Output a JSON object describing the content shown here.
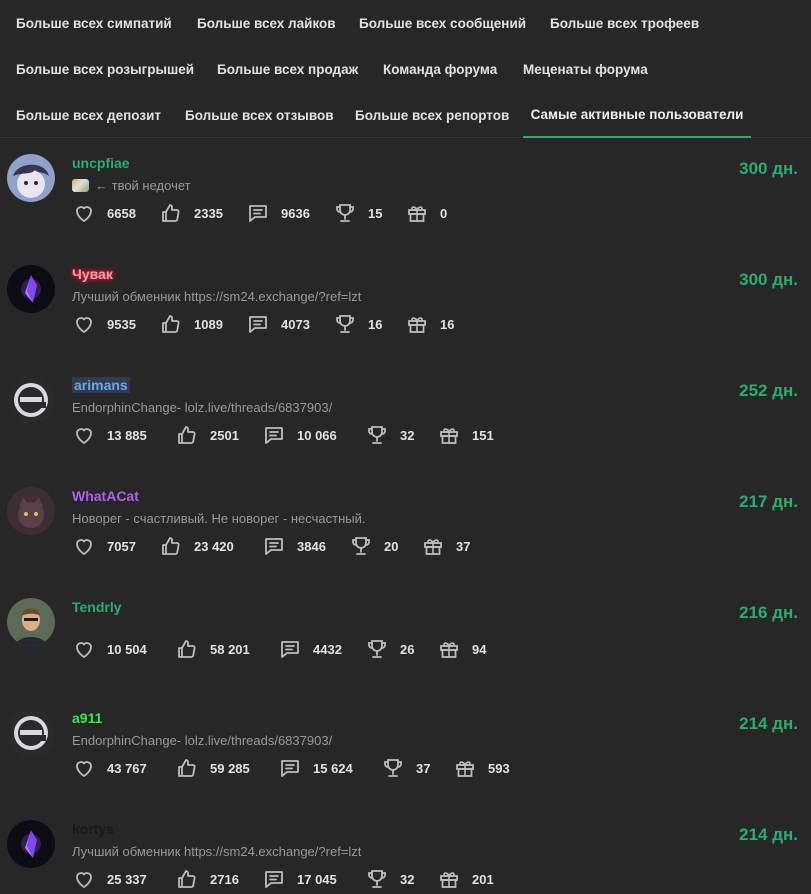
{
  "tabs": {
    "row1": [
      "Больше всех симпатий",
      "Больше всех лайков",
      "Больше всех сообщений",
      "Больше всех трофеев"
    ],
    "row2": [
      "Больше всех розыгрышей",
      "Больше всех продаж",
      "Команда форума",
      "Меценаты форума"
    ],
    "row3": [
      "Больше всех депозит",
      "Больше всех отзывов",
      "Больше всех репортов",
      "Самые активные пользователи"
    ],
    "active": "Самые активные пользователи"
  },
  "colors": {
    "accent": "#2bad72",
    "background": "#272727"
  },
  "users": [
    {
      "name": "uncpfiae",
      "name_color": "#2bad72",
      "name_style": "plain",
      "status": "← твой недочет",
      "status_has_emoji": true,
      "days": "300 дн.",
      "avatar": "anime-avatar",
      "stats": {
        "sympathies": "6658",
        "likes": "2335",
        "messages": "9636",
        "trophies": "15",
        "giveaways": "0"
      }
    },
    {
      "name": "Чувак",
      "name_color": "#ff5a6e",
      "name_style": "glow-red",
      "status": "Лучший обменник https://sm24.exchange/?ref=lzt",
      "status_has_emoji": false,
      "days": "300 дн.",
      "avatar": "purple-crystal-avatar",
      "stats": {
        "sympathies": "9535",
        "likes": "1089",
        "messages": "4073",
        "trophies": "16",
        "giveaways": "16"
      }
    },
    {
      "name": "arimans",
      "name_color": "#6fa6e8",
      "name_style": "highlight-blue",
      "status": "EndorphinChange- lolz.live/threads/6837903/",
      "status_has_emoji": false,
      "days": "252 дн.",
      "avatar": "e-logo-avatar",
      "stats": {
        "sympathies": "13 885",
        "likes": "2501",
        "messages": "10 066",
        "trophies": "32",
        "giveaways": "151"
      }
    },
    {
      "name": "WhatACat",
      "name_color": "#b25ff0",
      "name_style": "plain",
      "status": "Новорег - счастливый. Не новорег - несчастный.",
      "status_has_emoji": false,
      "days": "217 дн.",
      "avatar": "cat-avatar",
      "stats": {
        "sympathies": "7057",
        "likes": "23 420",
        "messages": "3846",
        "trophies": "20",
        "giveaways": "37"
      }
    },
    {
      "name": "Tendrly",
      "name_color": "#2bad72",
      "name_style": "plain",
      "status": "",
      "status_has_emoji": false,
      "days": "216 дн.",
      "avatar": "man-avatar",
      "stats": {
        "sympathies": "10 504",
        "likes": "58 201",
        "messages": "4432",
        "trophies": "26",
        "giveaways": "94"
      }
    },
    {
      "name": "a911",
      "name_color": "#37e94f",
      "name_style": "plain",
      "status": "EndorphinChange- lolz.live/threads/6837903/",
      "status_has_emoji": false,
      "days": "214 дн.",
      "avatar": "e-logo-avatar",
      "stats": {
        "sympathies": "43 767",
        "likes": "59 285",
        "messages": "15 624",
        "trophies": "37",
        "giveaways": "593"
      }
    },
    {
      "name": "kortys",
      "name_color": "#1a1a1a",
      "name_style": "plain",
      "status": "Лучший обменник https://sm24.exchange/?ref=lzt",
      "status_has_emoji": false,
      "days": "214 дн.",
      "avatar": "purple-crystal-avatar",
      "stats": {
        "sympathies": "25 337",
        "likes": "2716",
        "messages": "17 045",
        "trophies": "32",
        "giveaways": "201"
      }
    }
  ]
}
